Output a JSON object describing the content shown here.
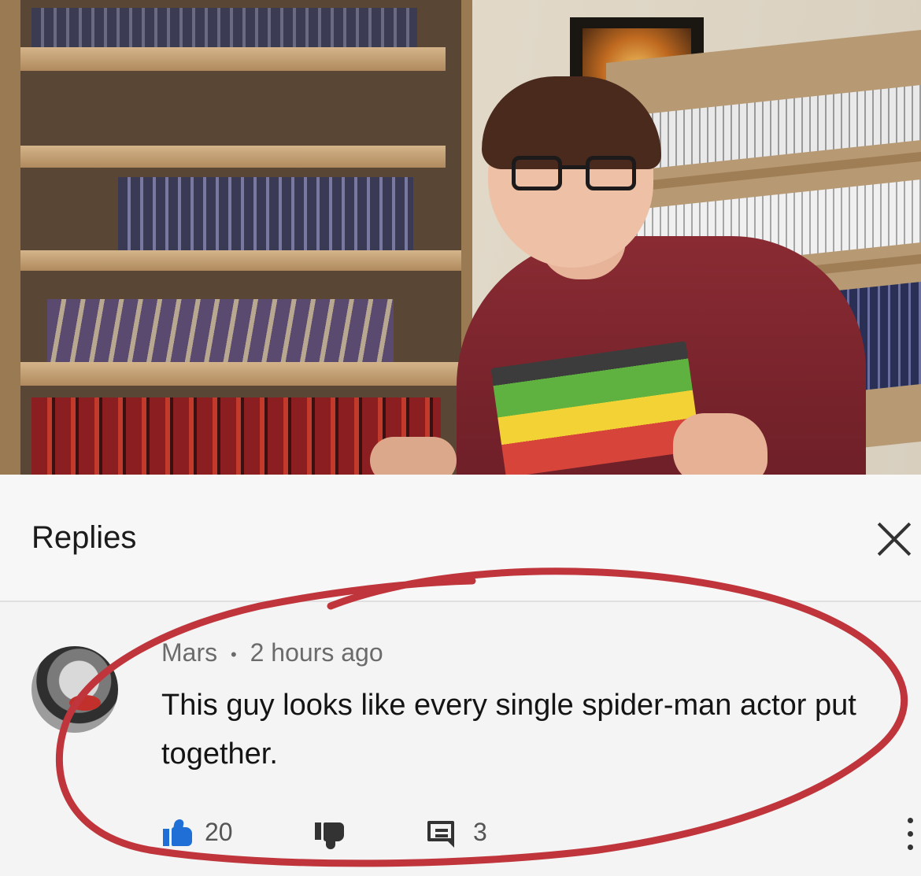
{
  "panel": {
    "title": "Replies"
  },
  "comment": {
    "author": "Mars",
    "separator": "•",
    "time": "2 hours ago",
    "text": "This guy looks like every single spider-man actor put together."
  },
  "actions": {
    "likes": "20",
    "replies": "3"
  },
  "colors": {
    "like_blue": "#1f6fd6",
    "annotation_red": "#c0353b",
    "shirt": "#7a242d"
  },
  "icons": [
    "close-icon",
    "thumbs-up-icon",
    "thumbs-down-icon",
    "reply-icon",
    "more-vert-icon"
  ]
}
